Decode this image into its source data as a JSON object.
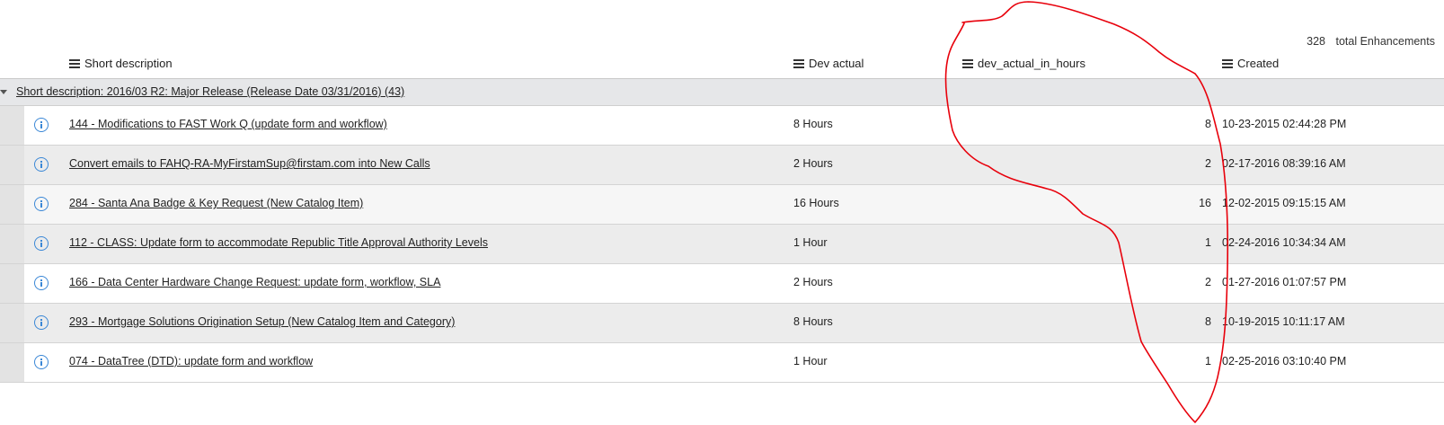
{
  "total": {
    "count": "328",
    "label": "total Enhancements"
  },
  "columns": {
    "short_description": "Short description",
    "dev_actual": "Dev actual",
    "dev_actual_in_hours": "dev_actual_in_hours",
    "created": "Created"
  },
  "group": {
    "label": "Short description: 2016/03 R2: Major Release (Release Date 03/31/2016) (43)"
  },
  "rows": [
    {
      "description": "144 - Modifications to FAST Work Q (update form and workflow)",
      "dev_actual": "8 Hours",
      "hours": "8",
      "created": "10-23-2015 02:44:28 PM"
    },
    {
      "description": "Convert emails to FAHQ-RA-MyFirstamSup@firstam.com into New Calls",
      "dev_actual": "2 Hours",
      "hours": "2",
      "created": "02-17-2016 08:39:16 AM"
    },
    {
      "description": "284 - Santa Ana Badge & Key Request (New Catalog Item)",
      "dev_actual": "16 Hours",
      "hours": "16",
      "created": "12-02-2015 09:15:15 AM"
    },
    {
      "description": "112 - CLASS: Update form to accommodate Republic Title Approval Authority Levels",
      "dev_actual": "1 Hour",
      "hours": "1",
      "created": "02-24-2016 10:34:34 AM"
    },
    {
      "description": "166 - Data Center Hardware Change Request: update form, workflow, SLA",
      "dev_actual": "2 Hours",
      "hours": "2",
      "created": "01-27-2016 01:07:57 PM"
    },
    {
      "description": "293 - Mortgage Solutions Origination Setup (New Catalog Item and Category)",
      "dev_actual": "8 Hours",
      "hours": "8",
      "created": "10-19-2015 10:11:17 AM"
    },
    {
      "description": "074 - DataTree (DTD): update form and workflow",
      "dev_actual": "1 Hour",
      "hours": "1",
      "created": "02-25-2016 03:10:40 PM"
    }
  ],
  "icons": {
    "column_menu": "menu-icon",
    "row_info": "info-icon",
    "group_toggle": "caret-down-icon"
  },
  "colors": {
    "info_icon": "#3a87d6",
    "annotation": "#e8000b",
    "group_background": "#e6e7e9"
  }
}
